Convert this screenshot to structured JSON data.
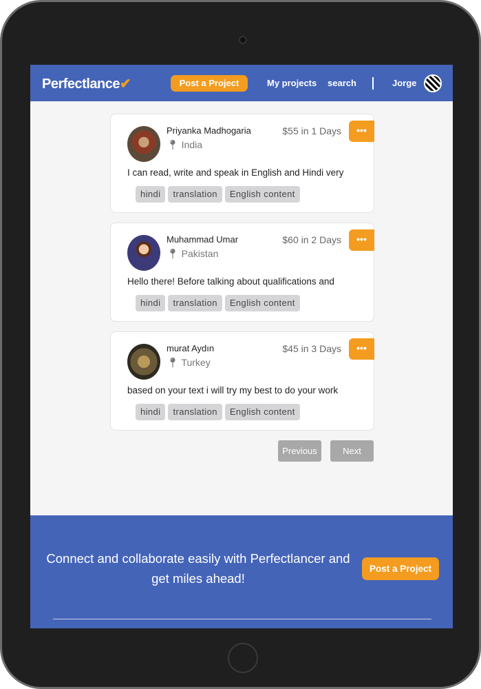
{
  "header": {
    "logo": "Perfectlance",
    "logo_mark": "✔",
    "post_project": "Post a Project",
    "my_projects": "My projects",
    "search": "search",
    "user": "Jorge"
  },
  "bids": [
    {
      "name": "Priyanka Madhogaria",
      "location": "India",
      "price": "$55 in 1 Days",
      "description": "I can read, write and speak in English and Hindi very",
      "tags": [
        "hindi",
        "translation",
        "English content"
      ],
      "menu": "•••"
    },
    {
      "name": "Muhammad Umar",
      "location": "Pakistan",
      "price": "$60 in 2 Days",
      "description": "Hello there! Before talking about qualifications and",
      "tags": [
        "hindi",
        "translation",
        "English content"
      ],
      "menu": "•••"
    },
    {
      "name": "murat Aydın",
      "location": "Turkey",
      "price": "$45 in 3 Days",
      "description": "based on your text i will try my best to do your work",
      "tags": [
        "hindi",
        "translation",
        "English content"
      ],
      "menu": "•••"
    }
  ],
  "pagination": {
    "previous": "Previous",
    "next": "Next"
  },
  "footer": {
    "text": "Connect and collaborate easily with Perfectlancer and get miles ahead!",
    "post_project": "Post a Project"
  },
  "colors": {
    "brand": "#4464b8",
    "accent": "#f39c1f"
  }
}
